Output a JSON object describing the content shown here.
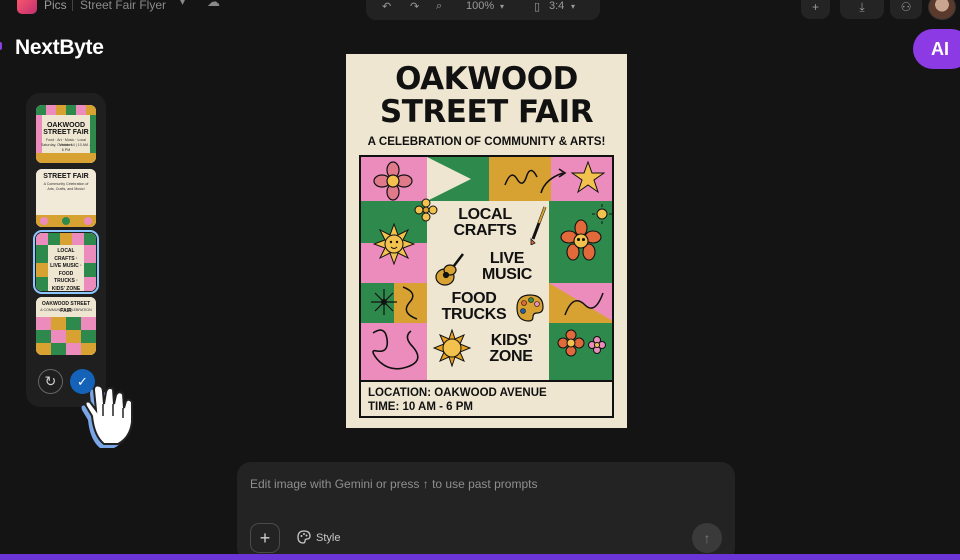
{
  "topbar": {
    "app_name": "Pics",
    "file_name": "Street Fair Flyer",
    "zoom": "100%",
    "aspect": "3:4"
  },
  "overlay": {
    "brand": "NextByte",
    "ai_badge": "AI"
  },
  "thumbnails": [
    {
      "title": "OAKWOOD STREET FAIR",
      "subtitle": "Food · Art · Music · Local Vendors",
      "date": "Saturday, October 14 | 10 AM – 6 PM"
    },
    {
      "title": "STREET FAIR",
      "subtitle": "A Community Celebration of Arts, Crafts, and Music!"
    },
    {
      "title": "LOCAL CRAFTS · LIVE MUSIC · FOOD TRUCKS · KIDS' ZONE",
      "selected": true
    },
    {
      "title": "OAKWOOD STREET FAIR",
      "subtitle": "A COMMUNITY CELEBRATION"
    }
  ],
  "poster": {
    "title_line1": "OAKWOOD",
    "title_line2": "STREET FAIR",
    "tagline": "A CELEBRATION OF COMMUNITY & ARTS!",
    "label_crafts_1": "LOCAL",
    "label_crafts_2": "CRAFTS",
    "label_music_1": "LIVE",
    "label_music_2": "MUSIC",
    "label_food_1": "FOOD",
    "label_food_2": "TRUCKS",
    "label_kids_1": "KIDS'",
    "label_kids_2": "ZONE",
    "location": "LOCATION: OAKWOOD AVENUE",
    "time": "TIME: 10 AM - 6 PM",
    "colors": {
      "cream": "#efe6d2",
      "pink": "#ec8cbc",
      "green": "#2e8a4c",
      "mustard": "#d8a233",
      "ink": "#111111"
    }
  },
  "prompt": {
    "placeholder": "Edit image with Gemini or press ↑ to use past prompts",
    "add_label": "+",
    "style_label": "Style"
  },
  "icons": [
    "app-logo-icon",
    "chevron-down-icon",
    "cloud-icon",
    "undo-icon",
    "redo-icon",
    "zoom-icon",
    "aspect-ratio-icon",
    "plus-icon",
    "download-icon",
    "add-person-icon",
    "refresh-icon",
    "checkmark-icon",
    "hand-cursor-icon",
    "palette-icon",
    "send-arrow-icon"
  ]
}
